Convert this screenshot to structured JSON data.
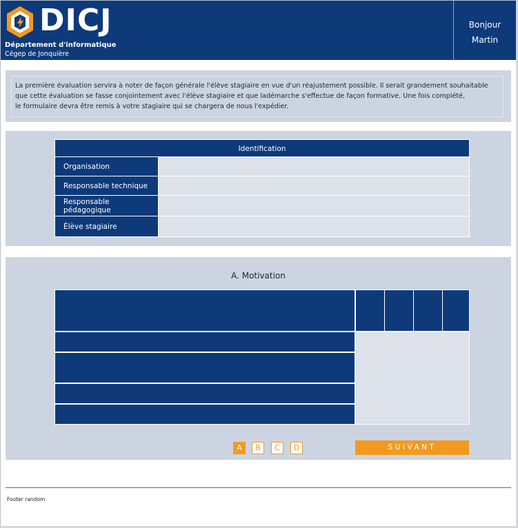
{
  "header": {
    "logo": {
      "name": "DICJ",
      "department": "Département d'informatique",
      "college": "Cégep de Jonquière"
    },
    "greeting": {
      "line1": "Bonjour",
      "line2": "Martin"
    }
  },
  "intro": {
    "lines": [
      "La première évaluation servira à noter de façon générale l'élève stagiaire en vue d'un réajustement possible. Il serait grandement souhaitable",
      "que cette évaluation se fasse conjointement avec l'élève stagiaire et que ladémarche s'effectue de façon formative. Une fois complété,",
      "le formulaire devra être remis à votre stagiaire qui se chargera de nous l'expédier."
    ]
  },
  "identification": {
    "title": "Identification",
    "rows": [
      {
        "label": "Organisation",
        "value": ""
      },
      {
        "label": "Responsable technique",
        "value": ""
      },
      {
        "label": "Responsable pédagogique",
        "value": ""
      },
      {
        "label": "Élève stagiaire",
        "value": ""
      }
    ]
  },
  "motivation": {
    "title": "A. Motivation",
    "pager": [
      "A",
      "B",
      "C",
      "D"
    ],
    "active_page": "A",
    "next_label": "SUIVANT"
  },
  "footer": {
    "text": "Footer random"
  },
  "colors": {
    "navy": "#0e3a7a",
    "panel": "#cdd4e1",
    "field": "#dde2ea",
    "accent": "#f29a1f"
  }
}
